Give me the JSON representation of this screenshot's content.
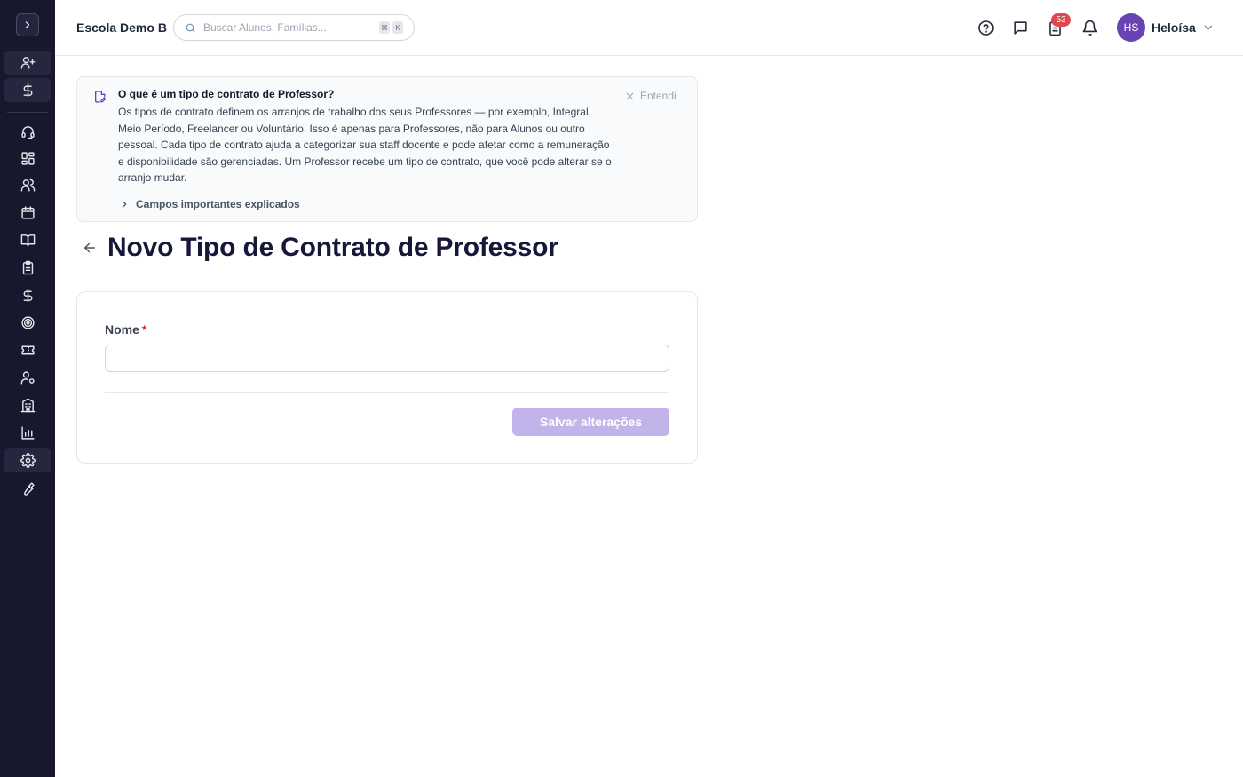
{
  "header": {
    "school_name": "Escola Demo B",
    "search_placeholder": "Buscar Alunos, Famílias...",
    "search_shortcut": [
      "⌘",
      "K"
    ],
    "tasks_count": "53",
    "user_initials": "HS",
    "user_name": "Heloísa"
  },
  "sidebar": {
    "items": [
      {
        "icon": "user-plus-icon"
      },
      {
        "icon": "dollar-icon"
      },
      {
        "icon": "headset-icon"
      },
      {
        "icon": "dashboard-icon"
      },
      {
        "icon": "users-icon"
      },
      {
        "icon": "calendar-icon"
      },
      {
        "icon": "book-icon"
      },
      {
        "icon": "clipboard-icon"
      },
      {
        "icon": "dollar-icon"
      },
      {
        "icon": "target-icon"
      },
      {
        "icon": "ticket-icon"
      },
      {
        "icon": "user-cog-icon"
      },
      {
        "icon": "building-icon"
      },
      {
        "icon": "bar-chart-icon"
      },
      {
        "icon": "gear-icon",
        "active": true
      },
      {
        "icon": "wrench-icon"
      }
    ]
  },
  "info_banner": {
    "title": "O que é um tipo de contrato de Professor?",
    "body": "Os tipos de contrato definem os arranjos de trabalho dos seus Professores — por exemplo, Integral, Meio Período, Freelancer ou Voluntário. Isso é apenas para Professores, não para Alunos ou outro pessoal. Cada tipo de contrato ajuda a categorizar sua staff docente e pode afetar como a remuneração e disponibilidade são gerenciadas. Um Professor recebe um tipo de contrato, que você pode alterar se o arranjo mudar.",
    "dismiss_label": "Entendi",
    "expander_label": "Campos importantes explicados"
  },
  "page": {
    "title": "Novo Tipo de Contrato de Professor"
  },
  "form": {
    "name_label": "Nome",
    "required_mark": "*",
    "name_value": "",
    "save_label": "Salvar alterações"
  },
  "colors": {
    "sidebar_bg": "#17172e",
    "accent": "#6843b3",
    "save_disabled": "#c2b3ea",
    "badge": "#e0484f"
  }
}
